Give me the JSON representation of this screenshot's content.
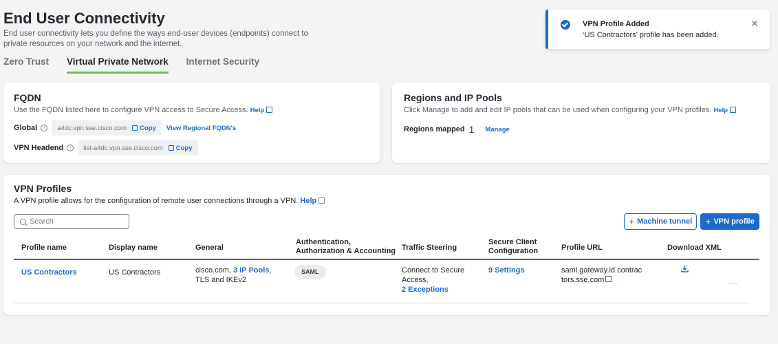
{
  "header": {
    "title": "End User Connectivity",
    "description_line1": "End user connectivity lets you define the ways end-user devices (endpoints) connect to",
    "description_line2": "private resources on your network and the internet."
  },
  "tabs": [
    {
      "label": "Zero Trust",
      "active": false
    },
    {
      "label": "Virtual Private Network",
      "active": true
    },
    {
      "label": "Internet Security",
      "active": false
    }
  ],
  "toast": {
    "title": "VPN Profile Added",
    "message": "‘US Contractors’ profile has been added.",
    "close": "✕"
  },
  "fqdn": {
    "title": "FQDN",
    "description": "Use the FQDN listed here to configure VPN access to Secure Access.",
    "help": "Help",
    "global_label": "Global",
    "global_value": "a4dc.vpn.sse.cisco.com",
    "copy_label": "Copy",
    "regional_link": "View Regional FQDN's",
    "headend_label": "VPN Headend",
    "headend_value": "list-a4dc.vpn.sse.cisco.com"
  },
  "regions": {
    "title": "Regions and IP Pools",
    "description": "Click Manage to add and edit IP pools that can be used when configuring your VPN profiles.",
    "help": "Help",
    "mapped_label": "Regions mapped",
    "mapped_count": "1",
    "manage": "Manage"
  },
  "profiles": {
    "title": "VPN Profiles",
    "description": "A VPN profile allows for the configuration of remote user connections through a VPN.",
    "help": "Help",
    "search_placeholder": "Search",
    "machine_tunnel": "Machine tunnel",
    "vpn_profile": "VPN profile",
    "columns": {
      "profile_name": "Profile name",
      "display_name": "Display name",
      "general": "General",
      "auth_line1": "Authentication,",
      "auth_line2": "Authorization & Accounting",
      "traffic": "Traffic Steering",
      "client_line1": "Secure Client",
      "client_line2": "Configuration",
      "profile_url": "Profile URL",
      "download": "Download XML"
    },
    "rows": [
      {
        "profile_name": "US Contractors",
        "display_name": "US Contractors",
        "general_prefix": "cisco.com,",
        "general_link": "3 IP Pools",
        "general_suffix": ",",
        "general_line2": "TLS and IKEv2",
        "auth": "SAML",
        "traffic_line1": "Connect to Secure",
        "traffic_line2": "Access,",
        "traffic_link": "2 Exceptions",
        "client_link": "9 Settings",
        "url_line1": "saml.gateway.id.contrac",
        "url_line2": "tors.sse.com"
      }
    ]
  },
  "colors": {
    "accent": "#1d69cc",
    "tab_indicator": "#6abf4b",
    "background": "#f4f4f5"
  }
}
